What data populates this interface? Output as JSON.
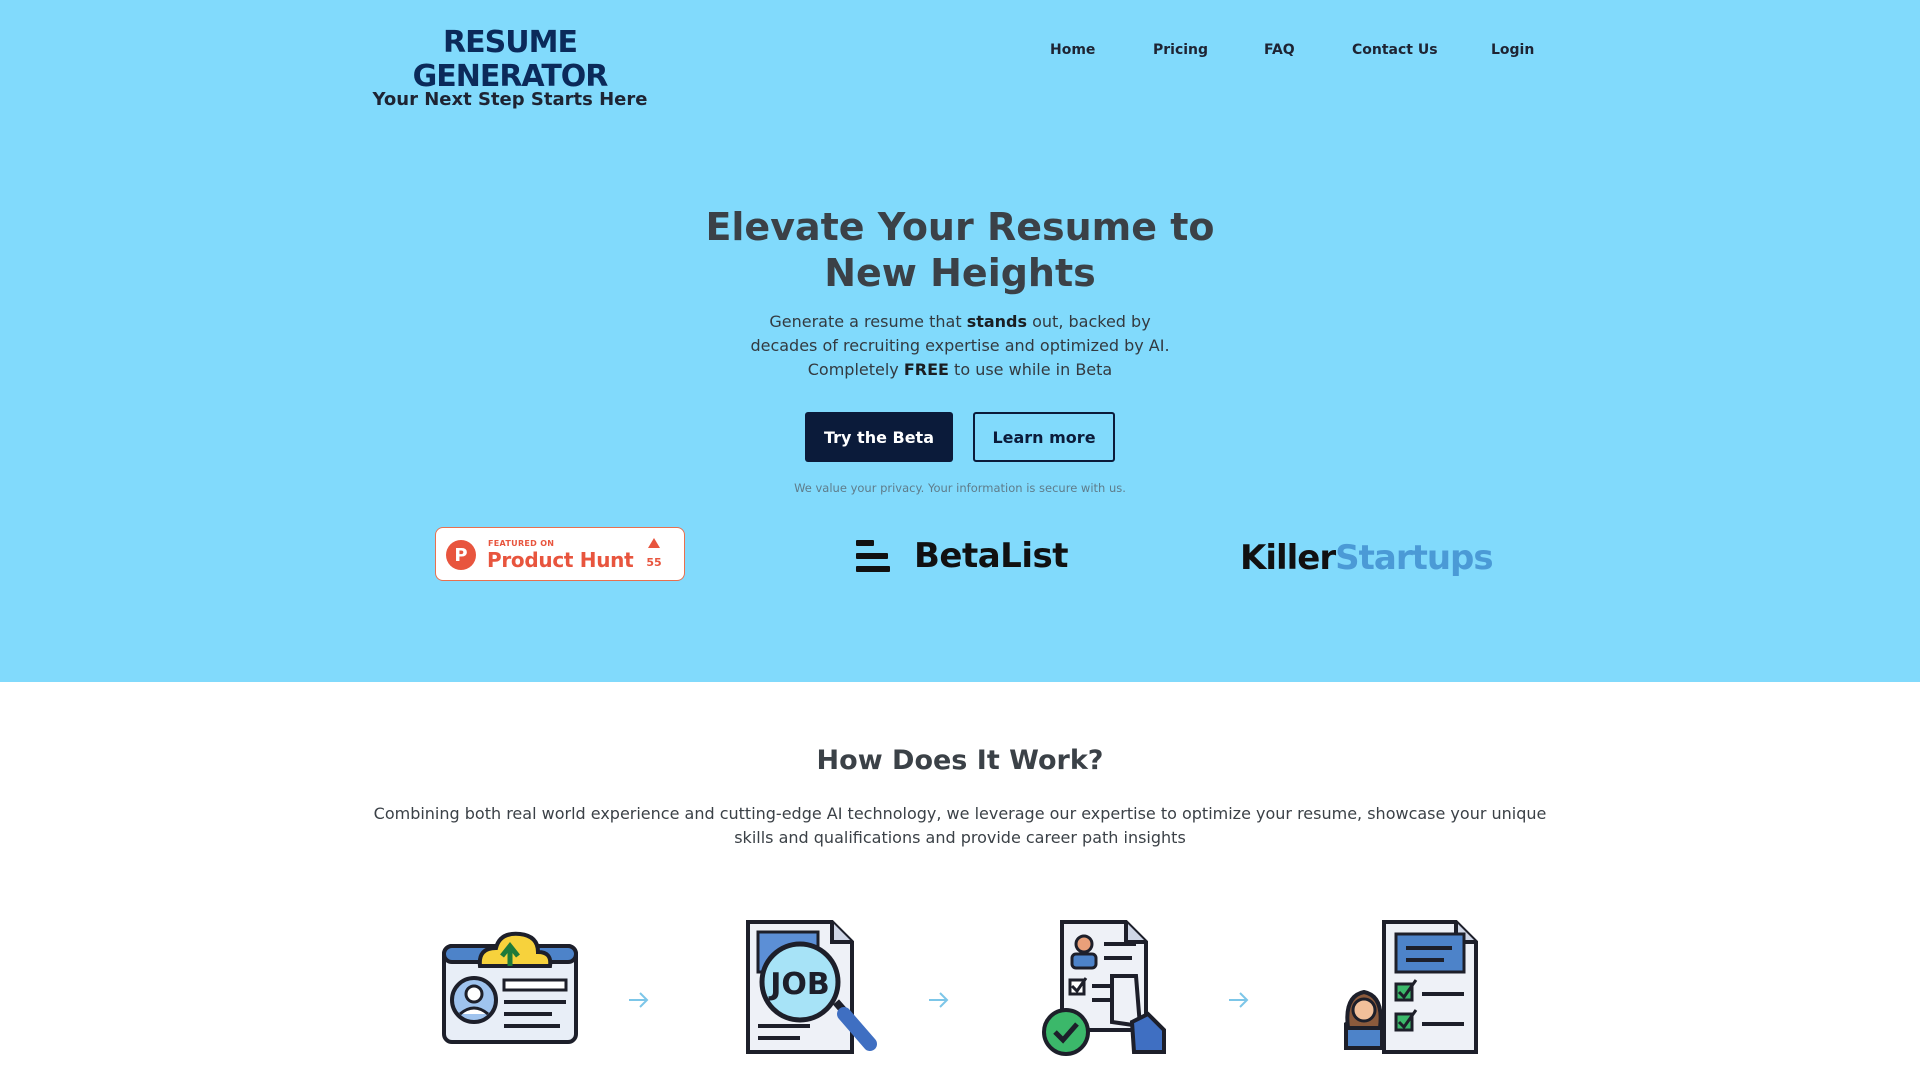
{
  "brand": {
    "title": "RESUME GENERATOR",
    "tagline": "Your Next Step Starts Here"
  },
  "nav": {
    "items": [
      "Home",
      "Pricing",
      "FAQ",
      "Contact Us",
      "Login"
    ]
  },
  "hero": {
    "headline": "Elevate Your Resume to New Heights",
    "subtitle": {
      "line1_prefix": "Generate a resume that ",
      "line1_bold": "stands",
      "line1_suffix": " out, backed by",
      "line2": "decades of recruiting expertise and optimized by AI.",
      "line3_prefix": "Completely ",
      "line3_bold": "FREE",
      "line3_suffix": " to use while in Beta"
    },
    "primary_button": "Try the Beta",
    "secondary_button": "Learn more",
    "privacy_note": "We value your privacy. Your information is secure with us."
  },
  "featured": {
    "product_hunt": {
      "small_label": "FEATURED ON",
      "name": "Product Hunt",
      "logo_letter": "P",
      "upvotes": "55"
    },
    "betalist": {
      "name": "BetaList"
    },
    "killer_startups": {
      "part1": "Killer",
      "part2": "Startups"
    }
  },
  "how_it_works": {
    "title": "How Does It Work?",
    "description": "Combining both real world experience and cutting-edge AI technology, we leverage our expertise to optimize your resume, showcase your unique skills and qualifications and provide career path insights",
    "job_label": "JOB",
    "steps": [
      {
        "icon": "upload-resume-icon"
      },
      {
        "icon": "job-search-icon"
      },
      {
        "icon": "resume-review-icon"
      },
      {
        "icon": "candidate-checklist-icon"
      }
    ]
  },
  "colors": {
    "hero_bg": "#81dafc",
    "primary": "#0b1b3a",
    "accent": "#4b9ad6",
    "product_hunt": "#e8553e"
  }
}
